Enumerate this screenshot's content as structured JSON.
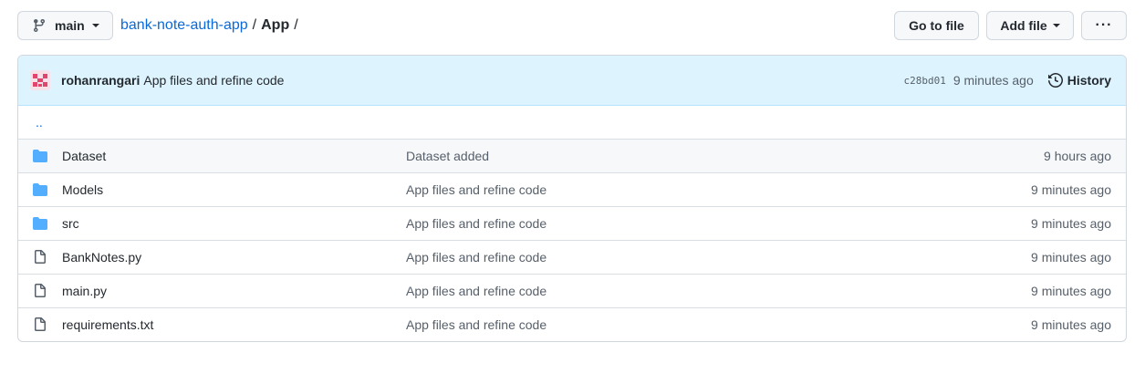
{
  "branch": {
    "label": "main"
  },
  "breadcrumb": {
    "repo": "bank-note-auth-app",
    "sep1": "/",
    "dir": "App",
    "sep2": "/"
  },
  "actions": {
    "goto": "Go to file",
    "add": "Add file",
    "more": "···"
  },
  "commit": {
    "author": "rohanrangari",
    "message": "App files and refine code",
    "sha": "c28bd01",
    "ago": "9 minutes ago",
    "history": "History"
  },
  "updir": "..",
  "files": [
    {
      "name": "Dataset",
      "type": "folder",
      "message": "Dataset added",
      "age": "9 hours ago"
    },
    {
      "name": "Models",
      "type": "folder",
      "message": "App files and refine code",
      "age": "9 minutes ago"
    },
    {
      "name": "src",
      "type": "folder",
      "message": "App files and refine code",
      "age": "9 minutes ago"
    },
    {
      "name": "BankNotes.py",
      "type": "file",
      "message": "App files and refine code",
      "age": "9 minutes ago"
    },
    {
      "name": "main.py",
      "type": "file",
      "message": "App files and refine code",
      "age": "9 minutes ago"
    },
    {
      "name": "requirements.txt",
      "type": "file",
      "message": "App files and refine code",
      "age": "9 minutes ago"
    }
  ],
  "colors": {
    "link": "#0969da",
    "folder": "#54aeff",
    "commit_bg": "#ddf4ff",
    "avatar": "#e0466d"
  }
}
